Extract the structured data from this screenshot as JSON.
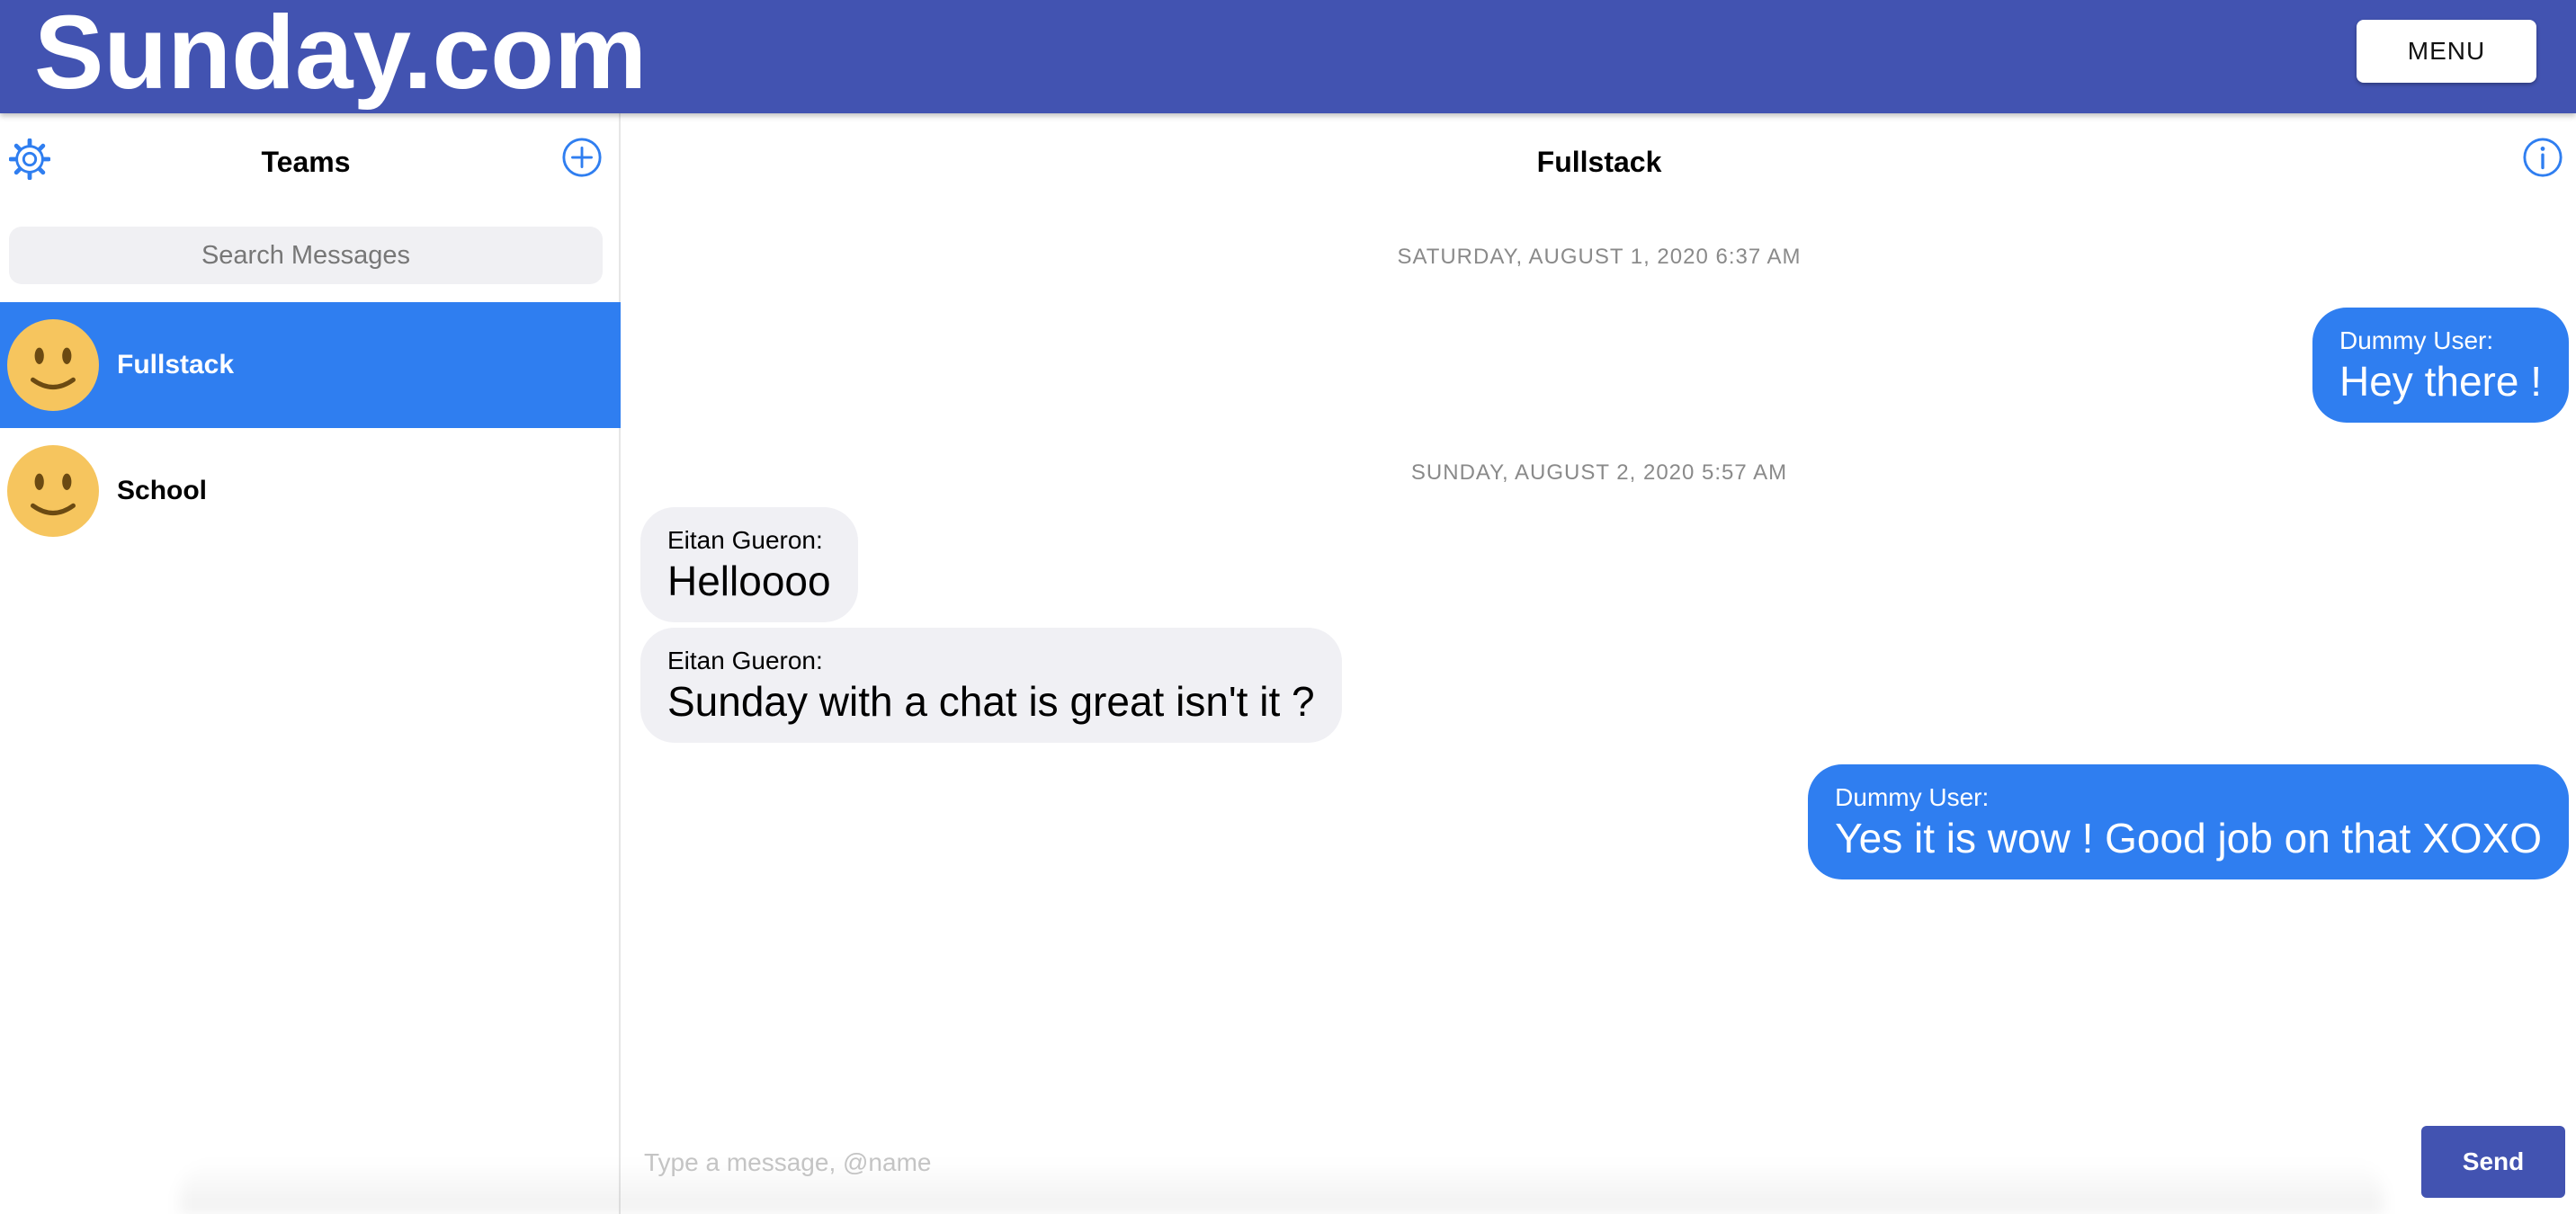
{
  "header": {
    "brand": "Sunday.com",
    "menu_label": "MENU"
  },
  "sidebar": {
    "title": "Teams",
    "settings_icon": "gear-icon",
    "add_icon": "plus-circle-icon",
    "search_placeholder": "Search Messages",
    "search_value": "",
    "chats": [
      {
        "name": "Fullstack",
        "avatar": "smiley-face-icon",
        "active": true
      },
      {
        "name": "School",
        "avatar": "smiley-face-icon",
        "active": false
      }
    ]
  },
  "conversation": {
    "title": "Fullstack",
    "info_icon": "info-icon",
    "groups": [
      {
        "date": "SATURDAY, AUGUST 1, 2020 6:37 AM",
        "messages": [
          {
            "sender": "Dummy User:",
            "text": "Hey there !",
            "direction": "outgoing"
          }
        ]
      },
      {
        "date": "SUNDAY, AUGUST 2, 2020 5:57 AM",
        "messages": [
          {
            "sender": "Eitan Gueron:",
            "text": "Helloooo",
            "direction": "incoming"
          },
          {
            "sender": "Eitan Gueron:",
            "text": "Sunday with a chat is great isn't it ?",
            "direction": "incoming"
          },
          {
            "sender": "Dummy User:",
            "text": "Yes it is wow ! Good job on that XOXO",
            "direction": "outgoing"
          }
        ]
      }
    ]
  },
  "composer": {
    "placeholder": "Type a message, @name",
    "value": "",
    "send_label": "Send"
  },
  "colors": {
    "appbar": "#4253b1",
    "accent_blue": "#2f7ef0",
    "incoming_bubble": "#f0f0f4",
    "avatar_yellow": "#f6c55e"
  }
}
